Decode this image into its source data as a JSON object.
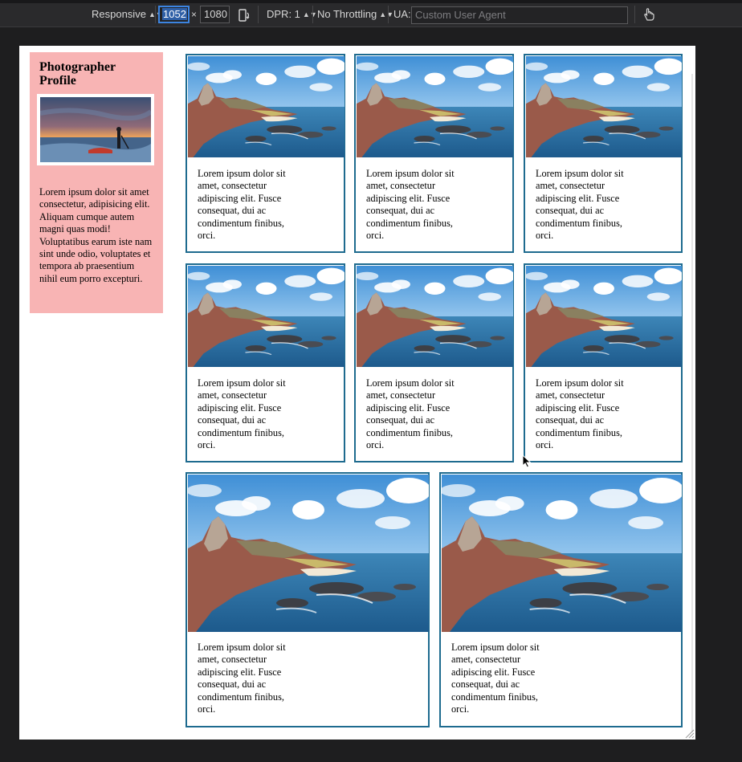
{
  "toolbar": {
    "device_mode": "Responsive",
    "width": "1052",
    "height": "1080",
    "times": "×",
    "dpr": "DPR: 1",
    "throttling": "No Throttling",
    "ua_label": "UA:",
    "ua_placeholder": "Custom User Agent"
  },
  "sidebar": {
    "title": "Photographer Profile",
    "bio": "Lorem ipsum dolor sit amet consectetur, adipisicing elit. Aliquam cumque autem magni quas modi! Voluptatibus earum iste nam sint unde odio, voluptates et tempora ab praesentium nihil eum porro excepturi."
  },
  "cards": [
    {
      "text": "Lorem ipsum dolor sit amet, consectetur adipiscing elit. Fusce consequat, dui ac condimentum finibus, orci."
    },
    {
      "text": "Lorem ipsum dolor sit amet, consectetur adipiscing elit. Fusce consequat, dui ac condimentum finibus, orci."
    },
    {
      "text": "Lorem ipsum dolor sit amet, consectetur adipiscing elit. Fusce consequat, dui ac condimentum finibus, orci."
    },
    {
      "text": "Lorem ipsum dolor sit amet, consectetur adipiscing elit. Fusce consequat, dui ac condimentum finibus, orci."
    },
    {
      "text": "Lorem ipsum dolor sit amet, consectetur adipiscing elit. Fusce consequat, dui ac condimentum finibus, orci."
    },
    {
      "text": "Lorem ipsum dolor sit amet, consectetur adipiscing elit. Fusce consequat, dui ac condimentum finibus, orci."
    },
    {
      "text": "Lorem ipsum dolor sit amet, consectetur adipiscing elit. Fusce consequat, dui ac condimentum finibus, orci."
    },
    {
      "text": "Lorem ipsum dolor sit amet, consectetur adipiscing elit. Fusce consequat, dui ac condimentum finibus, orci."
    }
  ],
  "colors": {
    "card_border": "#1e6b8f",
    "sidebar_bg": "#f8b4b4",
    "toolbar_bg": "#2a2a2c",
    "selection": "#3c84e0"
  },
  "icons": [
    "rotate-device-icon",
    "touch-simulation-icon",
    "mouse-cursor-icon",
    "resize-grip-icon",
    "sort-arrows-icon"
  ]
}
